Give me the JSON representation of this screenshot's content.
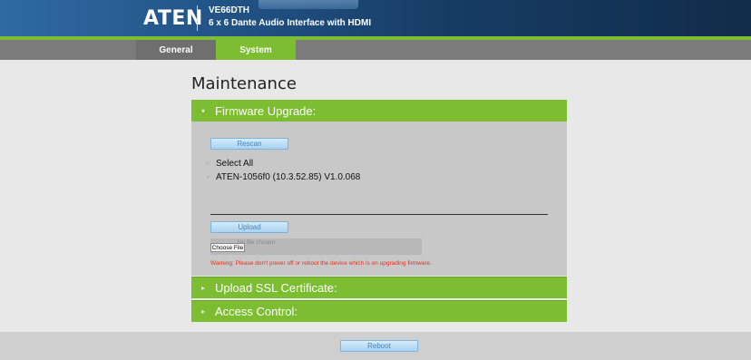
{
  "header": {
    "logo": "ATEN",
    "model": "VE66DTH",
    "subtitle": "6 x 6 Dante Audio Interface with HDMI"
  },
  "nav": {
    "tabs": [
      {
        "label": "General",
        "active": false
      },
      {
        "label": "System",
        "active": true
      }
    ]
  },
  "page": {
    "title": "Maintenance"
  },
  "firmware": {
    "section_title": "Firmware Upgrade:",
    "rescan_label": "Rescan",
    "select_all_label": "Select All",
    "device_label": "ATEN-1056f0 (10.3.52.85) V1.0.068",
    "upload_label": "Upload",
    "choose_file_label": "Choose File",
    "file_status": "No file chosen",
    "warning": "Warning: Please don't power off or reboot the device which is on upgrading firmware."
  },
  "sections": {
    "ssl_title": "Upload SSL Certificate:",
    "access_title": "Access Control:"
  },
  "footer": {
    "reboot_label": "Reboot"
  },
  "colors": {
    "accent_green": "#7cbd32",
    "header_blue": "#1f4f80",
    "warning_red": "#e53020"
  }
}
